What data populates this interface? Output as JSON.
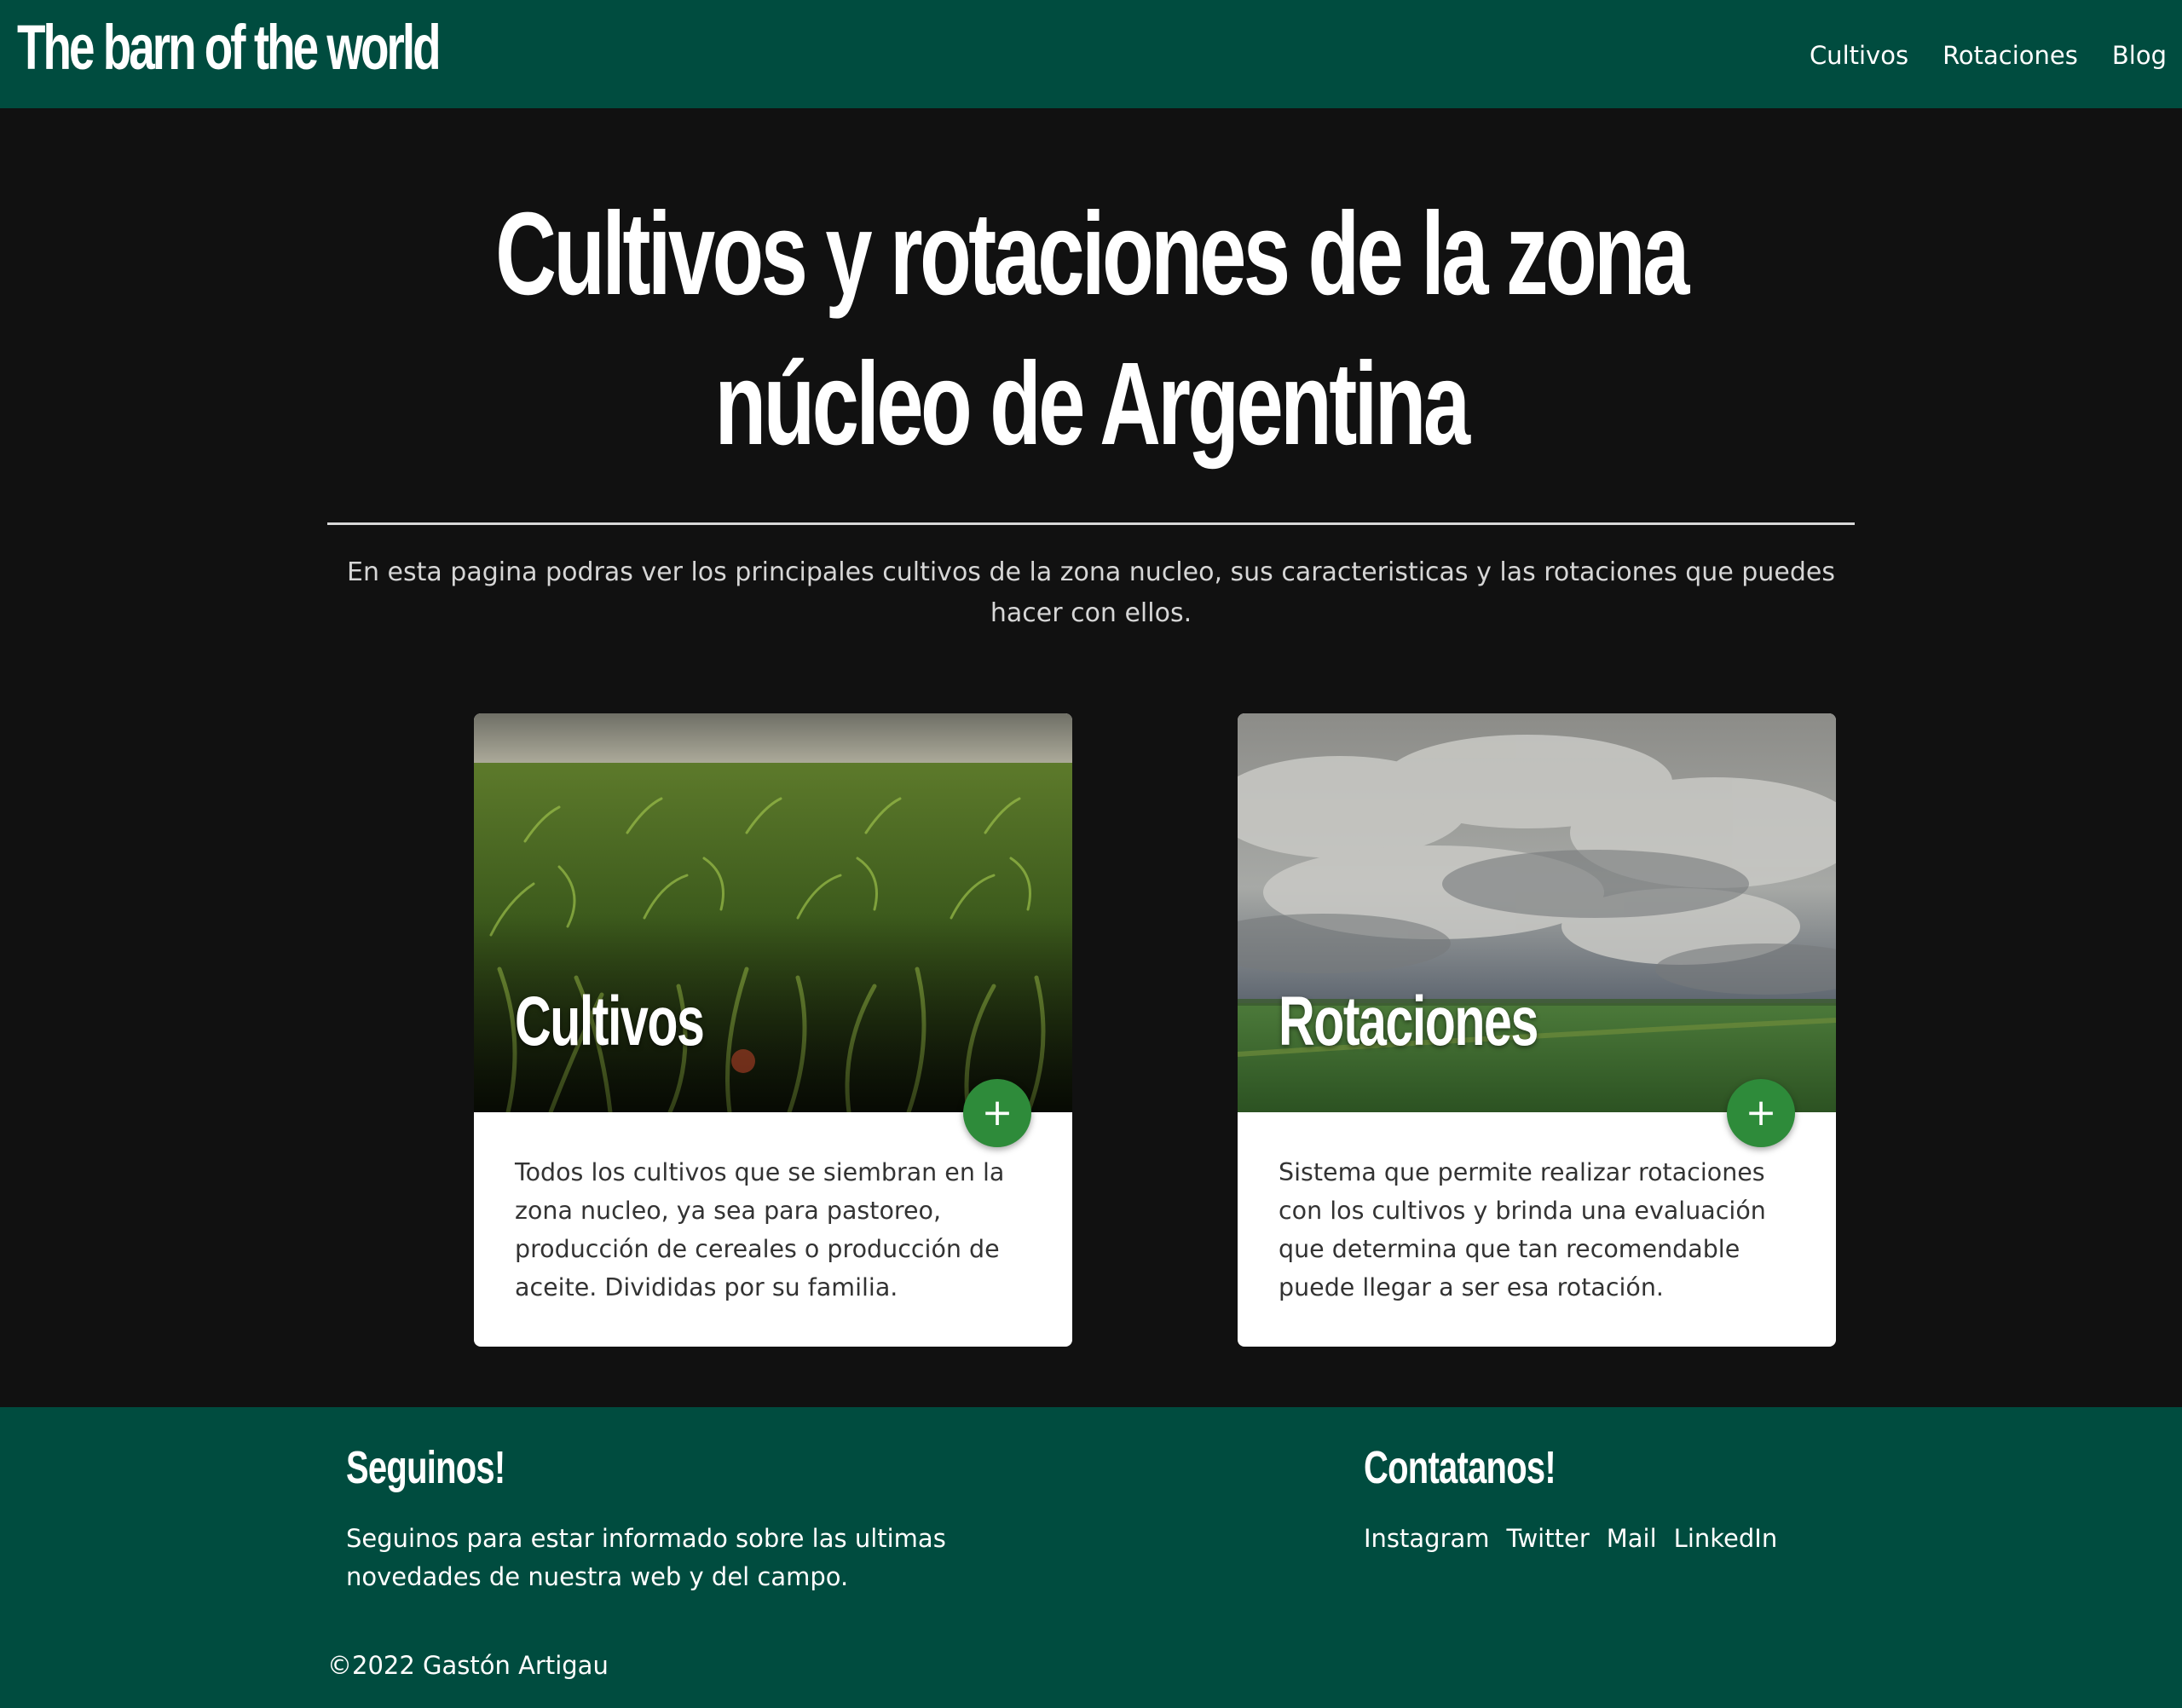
{
  "navbar": {
    "brand": "The barn of the world",
    "links": [
      "Cultivos",
      "Rotaciones",
      "Blog"
    ]
  },
  "hero": {
    "title_line1": "Cultivos y rotaciones de la zona",
    "title_line2": "núcleo de Argentina",
    "description": "En esta pagina podras ver los principales cultivos de la zona nucleo, sus caracteristicas y las rotaciones que puedes hacer con ellos."
  },
  "cards": [
    {
      "title": "Cultivos",
      "text": "Todos los cultivos que se siembran en la zona nucleo, ya sea para pastoreo, producción de cereales o producción de aceite. Divididas por su familia.",
      "button_icon": "plus-icon"
    },
    {
      "title": "Rotaciones",
      "text": "Sistema que permite realizar rotaciones con los cultivos y brinda una evaluación que determina que tan recomendable puede llegar a ser esa rotación.",
      "button_icon": "plus-icon"
    }
  ],
  "footer": {
    "follow_heading": "Seguinos!",
    "follow_text": "Seguinos para estar informado sobre las ultimas novedades de nuestra web y del campo.",
    "contact_heading": "Contatanos!",
    "social_links": [
      "Instagram",
      "Twitter",
      "Mail",
      "LinkedIn"
    ],
    "copyright": "©2022 Gastón Artigau"
  },
  "colors": {
    "header_footer_bg": "#004c3f",
    "page_bg": "#111111",
    "fab_green": "#2e8b3a",
    "card_bg": "#ffffff"
  }
}
